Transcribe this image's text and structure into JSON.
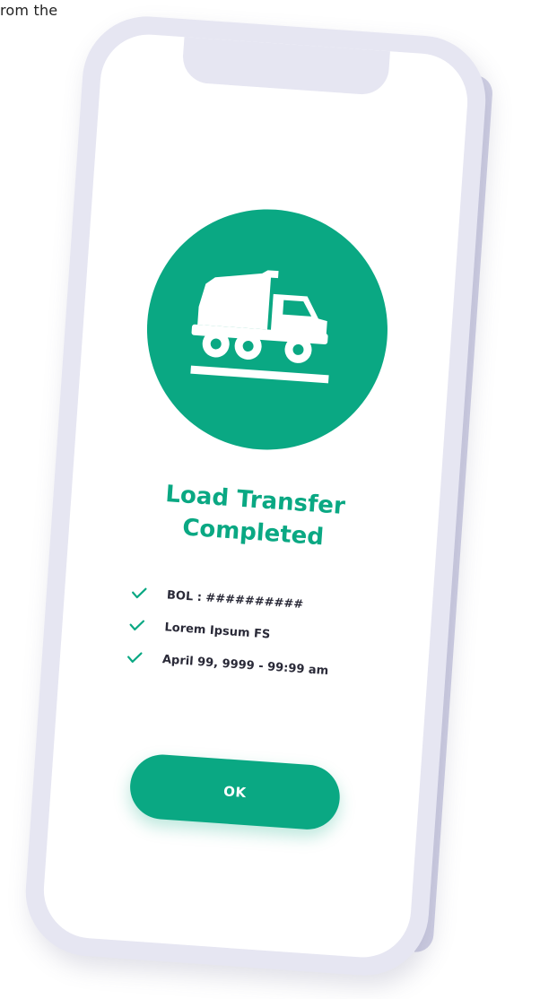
{
  "corner_text": "rom the",
  "screen": {
    "hero_icon": "dump-truck-icon",
    "title_line1": "Load Transfer",
    "title_line2": "Completed",
    "details": [
      {
        "icon": "check-icon",
        "text": "BOL : ##########"
      },
      {
        "icon": "check-icon",
        "text": "Lorem Ipsum FS"
      },
      {
        "icon": "check-icon",
        "text": "April 99, 9999 - 99:99 am"
      }
    ],
    "ok_label": "OK"
  },
  "colors": {
    "accent": "#0aa883",
    "phone_frame": "#e6e6f2",
    "text_dark": "#2a2a38",
    "background": "#ffffff"
  }
}
